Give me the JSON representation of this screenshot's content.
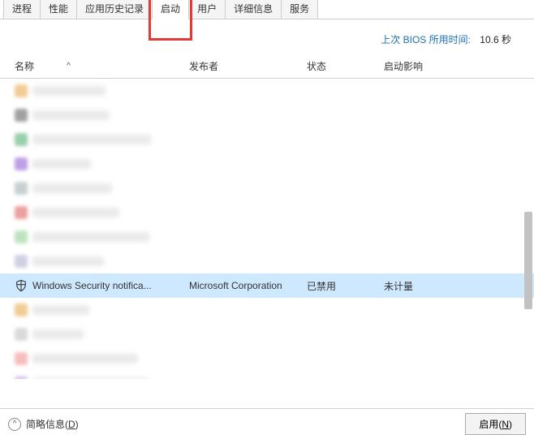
{
  "tabs": {
    "items": [
      "进程",
      "性能",
      "应用历史记录",
      "启动",
      "用户",
      "详细信息",
      "服务"
    ],
    "active_index": 3,
    "highlight_index": 3
  },
  "bios": {
    "label": "上次 BIOS 所用时间:",
    "value": "10.6 秒"
  },
  "columns": {
    "name": "名称",
    "pub": "发布者",
    "status": "状态",
    "impact": "启动影响",
    "sort_caret": "^"
  },
  "blurred_rows_before": 8,
  "selected_row": {
    "icon": "shield",
    "name": "Windows Security notifica...",
    "pub": "Microsoft Corporation",
    "status": "已禁用",
    "impact": "未计量"
  },
  "blurred_rows_after": 5,
  "blur_icon_colors": [
    "#e6a23c",
    "#555",
    "#4a6",
    "#8a4fd0",
    "#9aa",
    "#e05050",
    "#8c8",
    "#aac",
    "#e6a23c",
    "#bbb",
    "#e88",
    "#b8d",
    "#3a6fd0"
  ],
  "footer": {
    "brief_pre": "简略信息(",
    "brief_hot": "D",
    "brief_post": ")",
    "enable_pre": "启用(",
    "enable_hot": "N",
    "enable_post": ")"
  }
}
